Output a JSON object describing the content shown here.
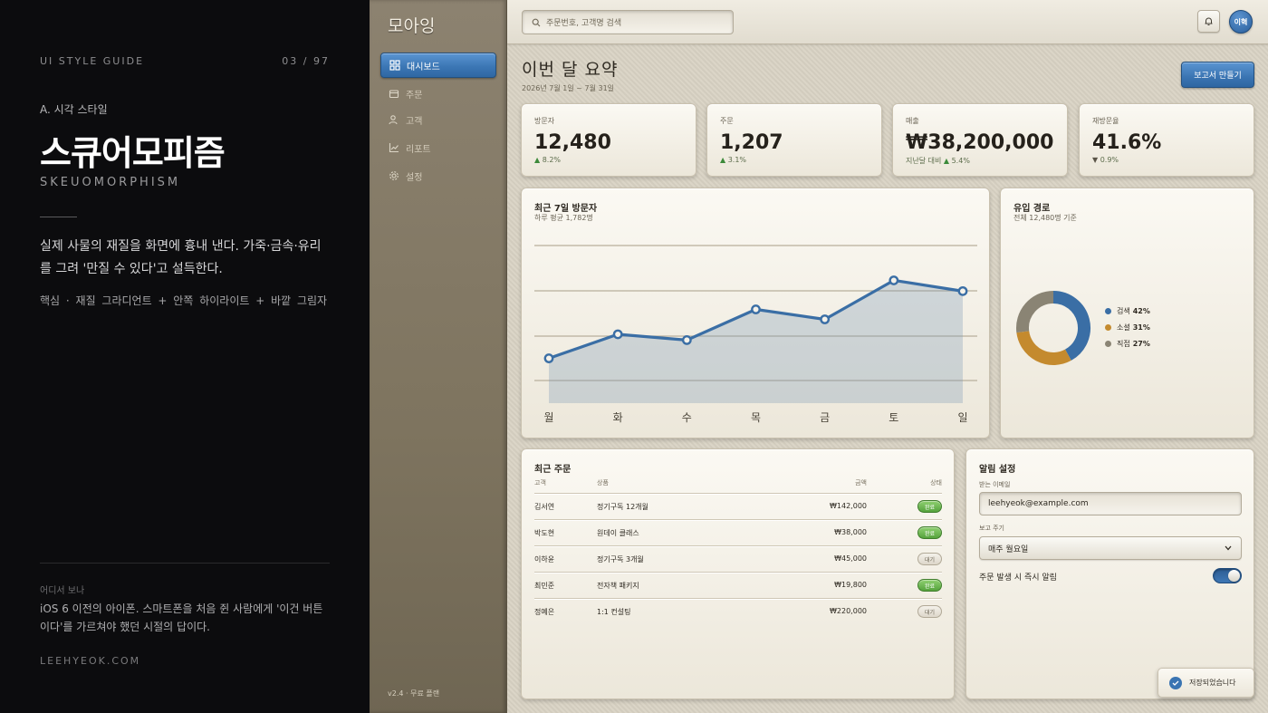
{
  "guide": {
    "header_left": "UI STYLE GUIDE",
    "header_right": "03 / 97",
    "section": "A. 시각 스타일",
    "title": "스큐어모피즘",
    "title_en": "SKEUOMORPHISM",
    "description": "실제 사물의 재질을 화면에 흉내 낸다. 가죽·금속·유리를 그려 '만질 수 있다'고 설득한다.",
    "core": "핵심 · 재질 그라디언트 + 안쪽 하이라이트 + 바깥 그림자",
    "where_label": "어디서 보나",
    "where_text": "iOS 6 이전의 아이폰. 스마트폰을 처음 쥔 사람에게 '이건 버튼이다'를 가르쳐야 했던 시절의 답이다.",
    "site": "LEEHYEOK.COM"
  },
  "sidebar": {
    "logo": "모아잉",
    "items": [
      {
        "label": "대시보드",
        "icon": "grid-icon",
        "active": true
      },
      {
        "label": "주문",
        "icon": "bag-icon",
        "active": false
      },
      {
        "label": "고객",
        "icon": "users-icon",
        "active": false
      },
      {
        "label": "리포트",
        "icon": "chart-icon",
        "active": false
      },
      {
        "label": "설정",
        "icon": "gear-icon",
        "active": false
      }
    ],
    "version": "v2.4 · 무료 플랜"
  },
  "topbar": {
    "search_placeholder": "주문번호, 고객명 검색",
    "avatar_text": "이혁"
  },
  "page": {
    "title": "이번 달 요약",
    "range": "2026년 7월 1일 ~ 7월 31일",
    "report_button": "보고서 만들기"
  },
  "stats": [
    {
      "label": "방문자",
      "value": "12,480",
      "prefix": "",
      "arrow": "▲",
      "change": "8.2%",
      "dir": "up"
    },
    {
      "label": "주문",
      "value": "1,207",
      "prefix": "",
      "arrow": "▲",
      "change": "3.1%",
      "dir": "up"
    },
    {
      "label": "매출",
      "value": "₩38,200,000",
      "prefix": "지난달 대비",
      "arrow": "▲",
      "change": "5.4%",
      "dir": "up"
    },
    {
      "label": "재방문율",
      "value": "41.6%",
      "prefix": "",
      "arrow": "▼",
      "change": "0.9%",
      "dir": "down"
    }
  ],
  "visitors": {
    "title": "최근 7일 방문자",
    "subtitle": "하루 평균 1,782명"
  },
  "traffic": {
    "title": "유입 경로",
    "subtitle": "전체 12,480명 기준"
  },
  "chart_data": [
    {
      "type": "area",
      "title": "최근 7일 방문자",
      "categories": [
        "월",
        "화",
        "수",
        "목",
        "금",
        "토",
        "일"
      ],
      "series": [
        {
          "values": [
            1340,
            1630,
            1560,
            1930,
            1810,
            2280,
            2150
          ]
        }
      ],
      "ylim": [
        800,
        2700
      ],
      "grid": true,
      "color": "#3a6ea5"
    },
    {
      "type": "pie",
      "title": "유입 경로",
      "categories": [
        "검색",
        "소셜",
        "직접"
      ],
      "values": [
        42,
        31,
        27
      ],
      "labels": [
        "42%",
        "31%",
        "27%"
      ],
      "colors": [
        "#3a6ea5",
        "#c48a2e",
        "#8a8474"
      ],
      "donut": true
    }
  ],
  "orders": {
    "title": "최근 주문",
    "headers": {
      "customer": "고객",
      "product": "상품",
      "amount": "금액",
      "status": "상태"
    },
    "rows": [
      {
        "customer": "김서연",
        "product": "정기구독 12개월",
        "amount": "₩142,000",
        "status": "완료",
        "state": "done"
      },
      {
        "customer": "박도현",
        "product": "원데이 클래스",
        "amount": "₩38,000",
        "status": "완료",
        "state": "done"
      },
      {
        "customer": "이하윤",
        "product": "정기구독 3개월",
        "amount": "₩45,000",
        "status": "대기",
        "state": "wait"
      },
      {
        "customer": "최민준",
        "product": "전자책 패키지",
        "amount": "₩19,800",
        "status": "완료",
        "state": "done"
      },
      {
        "customer": "정예은",
        "product": "1:1 컨설팅",
        "amount": "₩220,000",
        "status": "대기",
        "state": "wait"
      }
    ]
  },
  "settings": {
    "title": "알림 설정",
    "email_label": "받는 이메일",
    "email_value": "leehyeok@example.com",
    "period_label": "보고 주기",
    "period_value": "매주 월요일",
    "toggle_label": "주문 발생 시 즉시 알림",
    "toggle_on": true
  },
  "toast": {
    "text": "저장되었습니다"
  }
}
